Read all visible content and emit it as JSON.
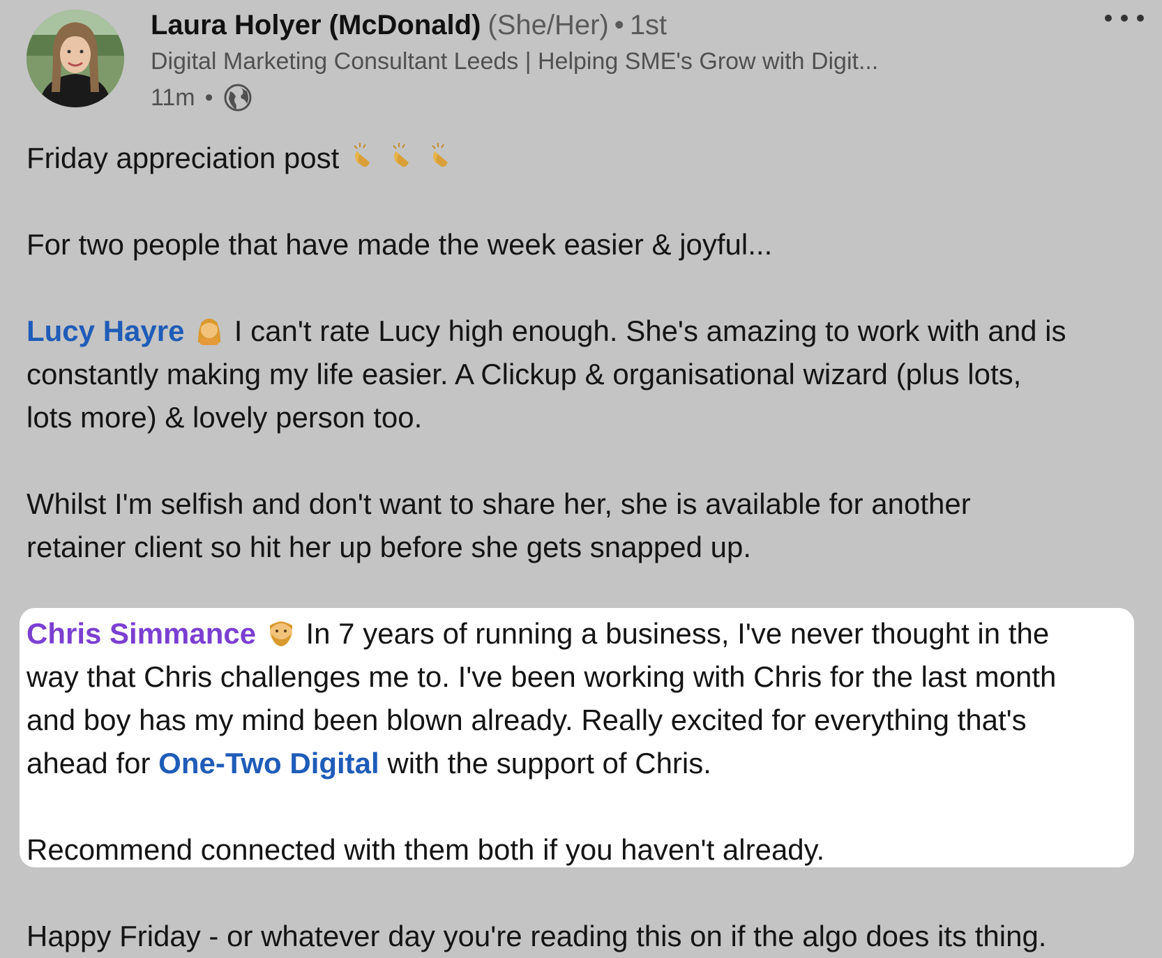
{
  "post": {
    "author": {
      "name": "Laura Holyer (McDonald)",
      "pronouns": "(She/Her)",
      "degree": "1st",
      "headline": "Digital Marketing Consultant Leeds | Helping SME's Grow with Digit...",
      "timestamp": "11m",
      "separator": "•"
    },
    "body": {
      "line1": "Friday appreciation post",
      "line2": "For two people that have made the week easier & joyful...",
      "lucy_mention": "Lucy Hayre",
      "lucy_text_1": "I can't rate Lucy high enough. She's amazing to work with and is",
      "lucy_text_2": "constantly making my life easier. A Clickup & organisational wizard (plus lots,",
      "lucy_text_3": "lots more) & lovely person too.",
      "whilst_1": "Whilst I'm selfish and don't want to share her, she is available for another",
      "whilst_2": "retainer client so hit her up before she gets snapped up.",
      "chris_mention": "Chris Simmance",
      "chris_text_1": "In 7 years of running a business, I've never thought in the",
      "chris_text_2": "way that Chris challenges me to. I've been working with Chris for the last month",
      "chris_text_3": "and boy has my mind been blown already. Really excited for everything that's",
      "chris_text_4a": "ahead for",
      "company_mention": "One-Two Digital",
      "chris_text_4b": "with the support of Chris.",
      "recommend": "Recommend connected with them both if you haven't already.",
      "closing": "Happy Friday - or whatever day you're reading this on if the algo does its thing."
    },
    "icons": {
      "more": "more-horizontal-icon",
      "visibility": "globe-icon",
      "clap": "clapping-hands-emoji",
      "woman": "woman-emoji",
      "man": "man-beard-emoji"
    }
  },
  "colors": {
    "background": "#c4c4c4",
    "highlight": "#ffffff",
    "mention_blue": "#1f5cb8",
    "mention_purple": "#7b3fd1",
    "meta_gray": "#505050"
  }
}
